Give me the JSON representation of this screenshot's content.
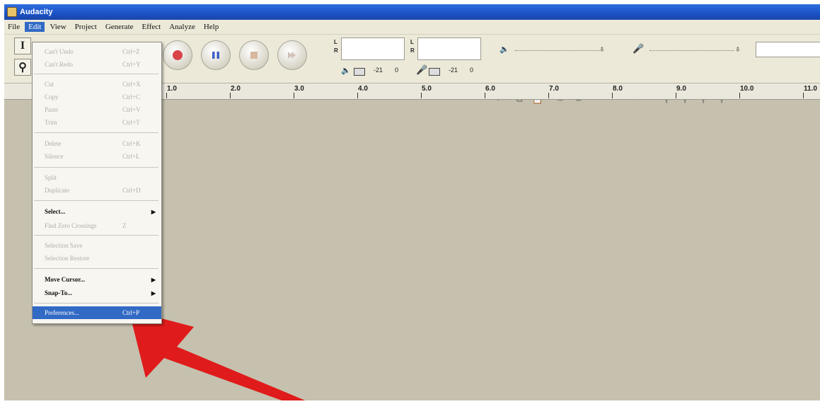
{
  "window": {
    "title": "Audacity"
  },
  "menubar": {
    "items": [
      {
        "label": "File"
      },
      {
        "label": "Edit"
      },
      {
        "label": "View"
      },
      {
        "label": "Project"
      },
      {
        "label": "Generate"
      },
      {
        "label": "Effect"
      },
      {
        "label": "Analyze"
      },
      {
        "label": "Help"
      }
    ],
    "open_index": 1
  },
  "edit_menu": {
    "items": [
      {
        "label": "Can't Undo",
        "shortcut": "Ctrl+Z",
        "enabled": false
      },
      {
        "label": "Can't Redo",
        "shortcut": "Ctrl+Y",
        "enabled": false
      },
      {
        "label": "Cut",
        "shortcut": "Ctrl+X",
        "enabled": false
      },
      {
        "label": "Copy",
        "shortcut": "Ctrl+C",
        "enabled": false
      },
      {
        "label": "Paste",
        "shortcut": "Ctrl+V",
        "enabled": false
      },
      {
        "label": "Trim",
        "shortcut": "Ctrl+T",
        "enabled": false
      },
      {
        "label": "Delete",
        "shortcut": "Ctrl+K",
        "enabled": false
      },
      {
        "label": "Silence",
        "shortcut": "Ctrl+L",
        "enabled": false
      },
      {
        "label": "Split",
        "shortcut": "",
        "enabled": false
      },
      {
        "label": "Duplicate",
        "shortcut": "Ctrl+D",
        "enabled": false
      },
      {
        "label": "Select...",
        "shortcut": "",
        "enabled": true,
        "submenu": true
      },
      {
        "label": "Find Zero Crossings",
        "shortcut": "Z",
        "enabled": false
      },
      {
        "label": "Selection Save",
        "shortcut": "",
        "enabled": false
      },
      {
        "label": "Selection Restore",
        "shortcut": "",
        "enabled": false
      },
      {
        "label": "Move Cursor...",
        "shortcut": "",
        "enabled": true,
        "submenu": true
      },
      {
        "label": "Snap-To...",
        "shortcut": "",
        "enabled": true,
        "submenu": true
      },
      {
        "label": "Preferences...",
        "shortcut": "Ctrl+P",
        "enabled": true,
        "highlighted": true
      }
    ]
  },
  "meters": {
    "playback": {
      "channel_l": "L",
      "channel_r": "R",
      "db": "-21",
      "zero": "0"
    },
    "record": {
      "channel_l": "L",
      "channel_r": "R",
      "db": "-21",
      "zero": "0"
    }
  },
  "ruler": {
    "labels": [
      "1.0",
      "2.0",
      "3.0",
      "4.0",
      "5.0",
      "6.0",
      "7.0",
      "8.0",
      "9.0",
      "10.0",
      "11.0"
    ]
  },
  "colors": {
    "title_bar": "#1b52c4",
    "menu_highlight": "#316ac5",
    "workspace": "#c5c1ae",
    "arrow": "#e01b1b",
    "record_button": "#d9434a",
    "pause_button": "#3f5ec9"
  }
}
